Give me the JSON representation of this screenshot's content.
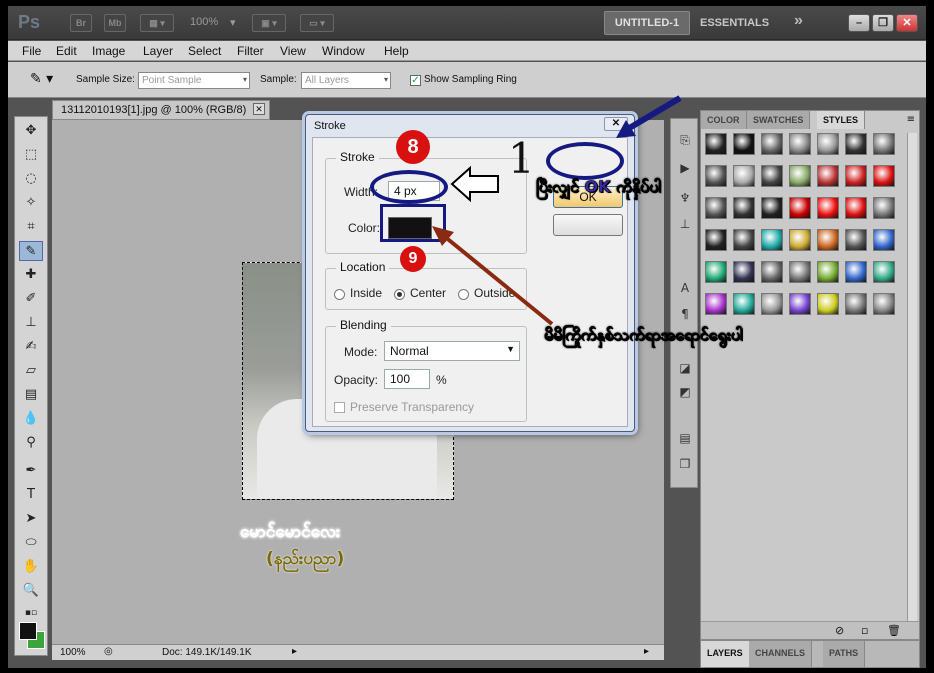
{
  "app": {
    "logo": "Ps",
    "title_buttons": [
      "Br",
      "Mb"
    ],
    "zoom": "100%",
    "workspace": "UNTITLED-1",
    "essentials": "ESSENTIALS",
    "chevron": "»",
    "win_controls": [
      "–",
      "❐",
      "✕"
    ]
  },
  "menu": [
    "File",
    "Edit",
    "Image",
    "Layer",
    "Select",
    "Filter",
    "View",
    "Window",
    "Help"
  ],
  "options": {
    "sample_size_label": "Sample Size:",
    "sample_size_value": "Point Sample",
    "sample_label": "Sample:",
    "sample_value": "All Layers",
    "ring_label": "Show Sampling Ring",
    "ring_checked": true
  },
  "document": {
    "tab_title": "13112010193[1].jpg @ 100% (RGB/8)",
    "close": "✕",
    "status_zoom": "100%",
    "status_doc": "Doc: 149.1K/149.1K"
  },
  "panels": {
    "tabs": [
      "COLOR",
      "SWATCHES",
      "STYLES"
    ],
    "active_tab": "STYLES",
    "bottom_tabs": [
      "LAYERS",
      "CHANNELS",
      "PATHS"
    ]
  },
  "dialog": {
    "title": "Stroke",
    "close": "✕",
    "stroke_group": "Stroke",
    "width_label": "Width:",
    "width_value": "4 px",
    "color_label": "Color:",
    "color_value": "#111111",
    "location_group": "Location",
    "locations": [
      "Inside",
      "Center",
      "Outside"
    ],
    "location_selected": "Center",
    "blending_group": "Blending",
    "mode_label": "Mode:",
    "mode_value": "Normal",
    "opacity_label": "Opacity:",
    "opacity_value": "100",
    "opacity_unit": "%",
    "preserve_label": "Preserve Transparency",
    "ok_label": "OK"
  },
  "annotations": {
    "step8": "8",
    "step9": "9",
    "big_one": "1",
    "ok_note": "ပြီးလျှင် OK ကိုနှိပ်ပါ",
    "color_note": "မိမိကြိုက်နှစ်သက်ရာအရောင်ရွေးပါ",
    "watermark_line1": "မောင်မောင်လေး",
    "watermark_line2": "(နည်းပညာ)"
  }
}
